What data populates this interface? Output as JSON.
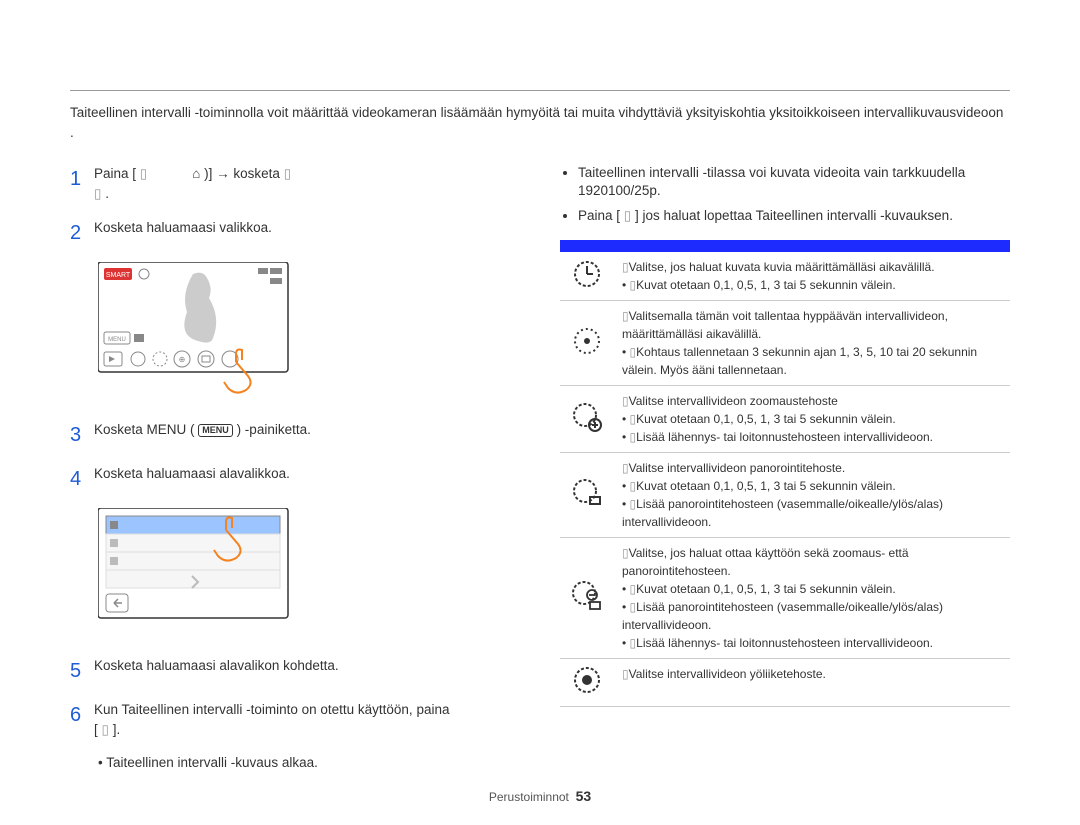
{
  "intro": "Taiteellinen intervalli -toiminnolla voit määrittää videokameran lisäämään hymyöitä tai muita vihdyttäviä yksityiskohtia yksitoikkoiseen intervallikuvausvideoon .",
  "steps": {
    "s1a": "Paina [",
    "s1b": ")] → kosketa",
    "s1home": "⌂",
    "s1tail": ".",
    "s2": "Kosketa haluamaasi valikkoa.",
    "s3a": "Kosketa MENU (",
    "s3b": ") -painiketta.",
    "s3pill": "MENU",
    "s4": "Kosketa haluamaasi alavalikkoa.",
    "s5": "Kosketa haluamaasi alavalikon kohdetta.",
    "s6": "Kun Taiteellinen intervalli -toiminto on otettu käyttöön, paina",
    "s6b": "[",
    "s6c": "].",
    "bullet_left": "Taiteellinen intervalli -kuvaus alkaa."
  },
  "right": {
    "n1": "Taiteellinen intervalli -tilassa voi kuvata videoita vain tarkkuudella 1920100/25p.",
    "n2a": "Paina [",
    "n2b": "] jos haluat lopettaa Taiteellinen intervalli -kuvauksen."
  },
  "table": {
    "h1": " ",
    "h2": " ",
    "r1": "Valitse, jos haluat kuvata kuvia määrittämälläsi aikavälillä.",
    "r1b": "Kuvat otetaan 0,1, 0,5, 1, 3 tai 5 sekunnin välein.",
    "r2": "Valitsemalla tämän voit tallentaa hyppäävän intervallivideon, määrittämälläsi aikavälillä.",
    "r2b": "Kohtaus tallennetaan 3 sekunnin ajan 1, 3, 5, 10 tai 20 sekunnin välein. Myös ääni tallennetaan.",
    "r3": "Valitse intervallivideon zoomaustehoste",
    "r3b": "Kuvat otetaan 0,1, 0,5, 1, 3 tai 5 sekunnin välein.",
    "r3c": "Lisää lähennys- tai loitonnustehosteen intervallivideoon.",
    "r4": "Valitse intervallivideon panorointitehoste.",
    "r4b": "Kuvat otetaan 0,1, 0,5, 1, 3 tai 5 sekunnin välein.",
    "r4c": "Lisää panorointitehosteen (vasemmalle/oikealle/ylös/alas) intervallivideoon.",
    "r5": "Valitse, jos haluat ottaa käyttöön sekä zoomaus- että panorointitehosteen.",
    "r5b": "Kuvat otetaan 0,1, 0,5, 1, 3 tai 5 sekunnin välein.",
    "r5c": "Lisää panorointitehosteen (vasemmalle/oikealle/ylös/alas) intervallivideoon.",
    "r5d": "Lisää lähennys- tai loitonnustehosteen intervallivideoon.",
    "r6": "Valitse intervallivideon yöliiketehoste."
  },
  "footer": {
    "section": "Perustoiminnot",
    "page": "53"
  }
}
